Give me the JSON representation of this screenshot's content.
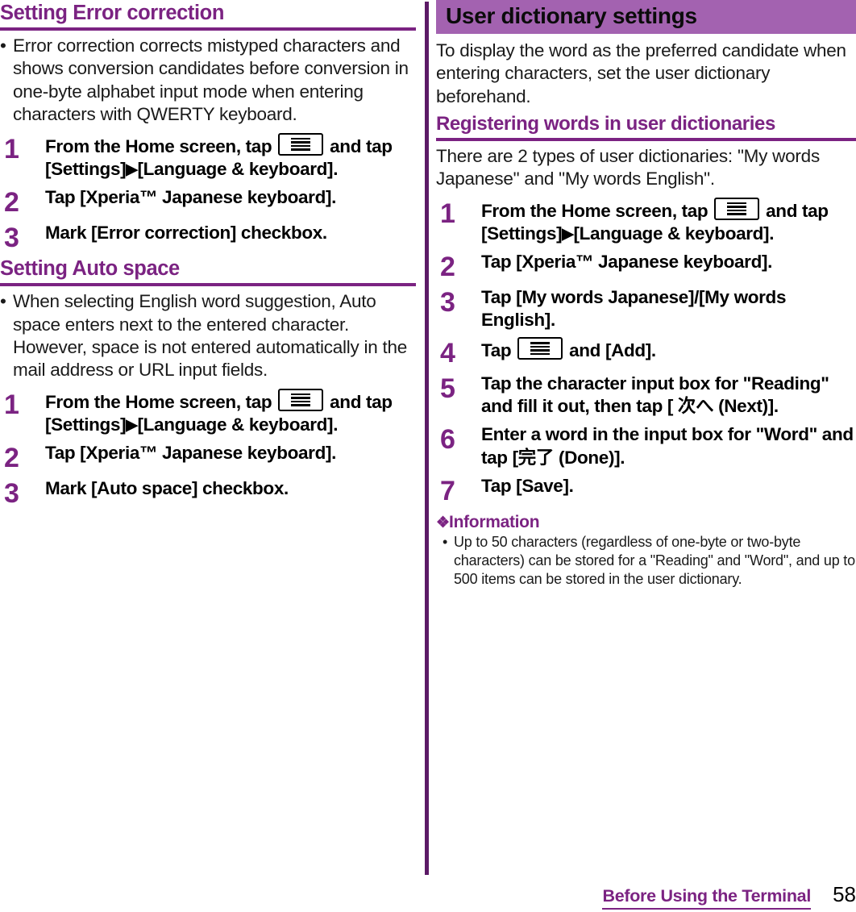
{
  "colors": {
    "heading_purple": "#7B2382",
    "band_purple": "#A362B0",
    "divider_purple": "#5C1A66",
    "body_black": "#1a1a1a"
  },
  "left_column": {
    "sections": [
      {
        "heading": "Setting Error correction",
        "heading_style": "rule",
        "bullets": [
          "Error correction corrects mistyped characters and shows conversion candidates before conversion in one-byte alphabet input mode when entering characters with QWERTY keyboard."
        ],
        "steps": [
          {
            "number": "1",
            "parts": [
              {
                "type": "text",
                "value": "From the Home screen, tap "
              },
              {
                "type": "icon",
                "value": "menu-key-icon"
              },
              {
                "type": "text",
                "value": " and tap [Settings]"
              },
              {
                "type": "triangle",
                "value": "▶"
              },
              {
                "type": "text",
                "value": "[Language & keyboard]."
              }
            ]
          },
          {
            "number": "2",
            "parts": [
              {
                "type": "text",
                "value": "Tap [Xperia™ Japanese keyboard]."
              }
            ]
          },
          {
            "number": "3",
            "parts": [
              {
                "type": "text",
                "value": "Mark [Error correction] checkbox."
              }
            ]
          }
        ]
      },
      {
        "heading": "Setting Auto space",
        "heading_style": "rule",
        "bullets": [
          "When selecting English word suggestion, Auto space enters next to the entered character. However, space is not entered automatically in the mail address or URL input fields."
        ],
        "steps": [
          {
            "number": "1",
            "parts": [
              {
                "type": "text",
                "value": "From the Home screen, tap "
              },
              {
                "type": "icon",
                "value": "menu-key-icon"
              },
              {
                "type": "text",
                "value": " and tap [Settings]"
              },
              {
                "type": "triangle",
                "value": "▶"
              },
              {
                "type": "text",
                "value": "[Language & keyboard]."
              }
            ]
          },
          {
            "number": "2",
            "parts": [
              {
                "type": "text",
                "value": "Tap [Xperia™ Japanese keyboard]."
              }
            ]
          },
          {
            "number": "3",
            "parts": [
              {
                "type": "text",
                "value": "Mark [Auto space] checkbox."
              }
            ]
          }
        ]
      }
    ]
  },
  "right_column": {
    "band_heading": "User dictionary settings",
    "intro": "To display the word as the preferred candidate when entering characters, set the user dictionary beforehand.",
    "sub_heading": "Registering words in user dictionaries",
    "sub_intro": "There are 2 types of user dictionaries: \"My words Japanese\" and \"My words English\".",
    "steps": [
      {
        "number": "1",
        "parts": [
          {
            "type": "text",
            "value": "From the Home screen, tap "
          },
          {
            "type": "icon",
            "value": "menu-key-icon"
          },
          {
            "type": "text",
            "value": " and tap [Settings]"
          },
          {
            "type": "triangle",
            "value": "▶"
          },
          {
            "type": "text",
            "value": "[Language & keyboard]."
          }
        ]
      },
      {
        "number": "2",
        "parts": [
          {
            "type": "text",
            "value": "Tap [Xperia™ Japanese keyboard]."
          }
        ]
      },
      {
        "number": "3",
        "parts": [
          {
            "type": "text",
            "value": "Tap [My words Japanese]/[My words English]."
          }
        ]
      },
      {
        "number": "4",
        "parts": [
          {
            "type": "text",
            "value": "Tap "
          },
          {
            "type": "icon",
            "value": "menu-key-icon"
          },
          {
            "type": "text",
            "value": " and [Add]."
          }
        ]
      },
      {
        "number": "5",
        "parts": [
          {
            "type": "text",
            "value": "Tap the character input box for \"Reading\" and fill it out, then tap [ 次へ (Next)]."
          }
        ]
      },
      {
        "number": "6",
        "parts": [
          {
            "type": "text",
            "value": "Enter a word in the input box for \"Word\" and tap [完了 (Done)]."
          }
        ]
      },
      {
        "number": "7",
        "parts": [
          {
            "type": "text",
            "value": "Tap [Save]."
          }
        ]
      }
    ],
    "information": {
      "diamond": "❖",
      "title": "Information",
      "items": [
        "Up to 50 characters (regardless of one-byte or two-byte characters) can be stored for a \"Reading\" and \"Word\", and up to 500 items can be stored in the user dictionary."
      ]
    }
  },
  "footer": {
    "chapter": "Before Using the Terminal",
    "page_number": "58"
  }
}
